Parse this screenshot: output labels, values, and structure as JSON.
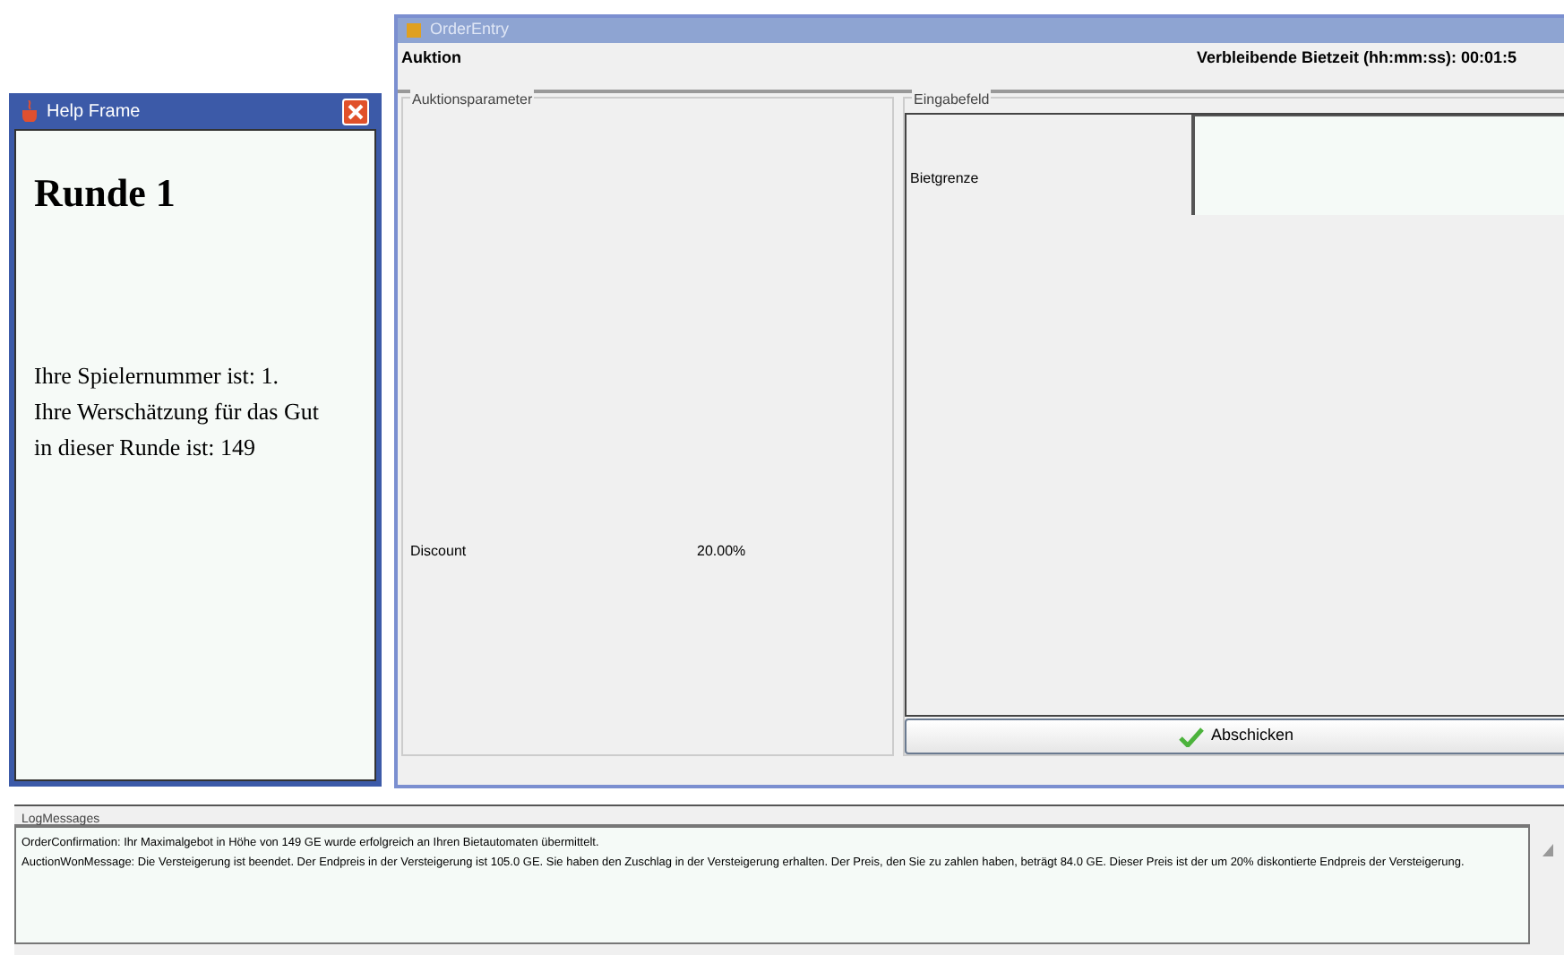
{
  "help_frame": {
    "title": "Help Frame",
    "heading": "Runde 1",
    "lines": [
      "Ihre Spielernummer ist: 1.",
      "Ihre Werschätzung für das Gut",
      "in dieser Runde ist: 149"
    ]
  },
  "order_entry": {
    "title": "OrderEntry",
    "header_left": "Auktion",
    "header_right": "Verbleibende Bietzeit (hh:mm:ss): 00:01:5",
    "params": {
      "legend": "Auktionsparameter",
      "rows": [
        {
          "label": "Discount",
          "value": "20.00%"
        }
      ]
    },
    "input": {
      "legend": "Eingabefeld",
      "label": "Bietgrenze"
    },
    "submit": "Abschicken"
  },
  "log": {
    "legend": "LogMessages",
    "messages": [
      "OrderConfirmation: Ihr Maximalgebot in Höhe von 149 GE wurde erfolgreich an Ihren Bietautomaten übermittelt.",
      "AuctionWonMessage: Die Versteigerung ist beendet. Der Endpreis in der Versteigerung ist 105.0 GE. Sie haben den Zuschlag in der Versteigerung erhalten. Der Preis, den Sie zu zahlen haben, beträgt 84.0 GE. Dieser Preis ist der um 20% diskontierte Endpreis der Versteigerung."
    ]
  }
}
